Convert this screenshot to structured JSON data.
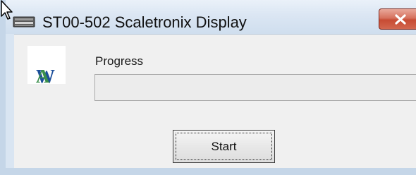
{
  "window": {
    "title": "ST00-502 Scaletronix Display",
    "app_icon": "keyboard-icon",
    "close_icon": "close-icon"
  },
  "logo": {
    "text_w": "W",
    "text_a": "A"
  },
  "progress": {
    "label": "Progress",
    "value_fraction": 0
  },
  "buttons": {
    "start_label": "Start"
  },
  "colors": {
    "title_bar": "#dbe6f3",
    "close_button": "#c74b33",
    "client_background": "#f0f0f0",
    "logo_blue": "#1b4e9a",
    "logo_green": "#3a8f4c"
  }
}
